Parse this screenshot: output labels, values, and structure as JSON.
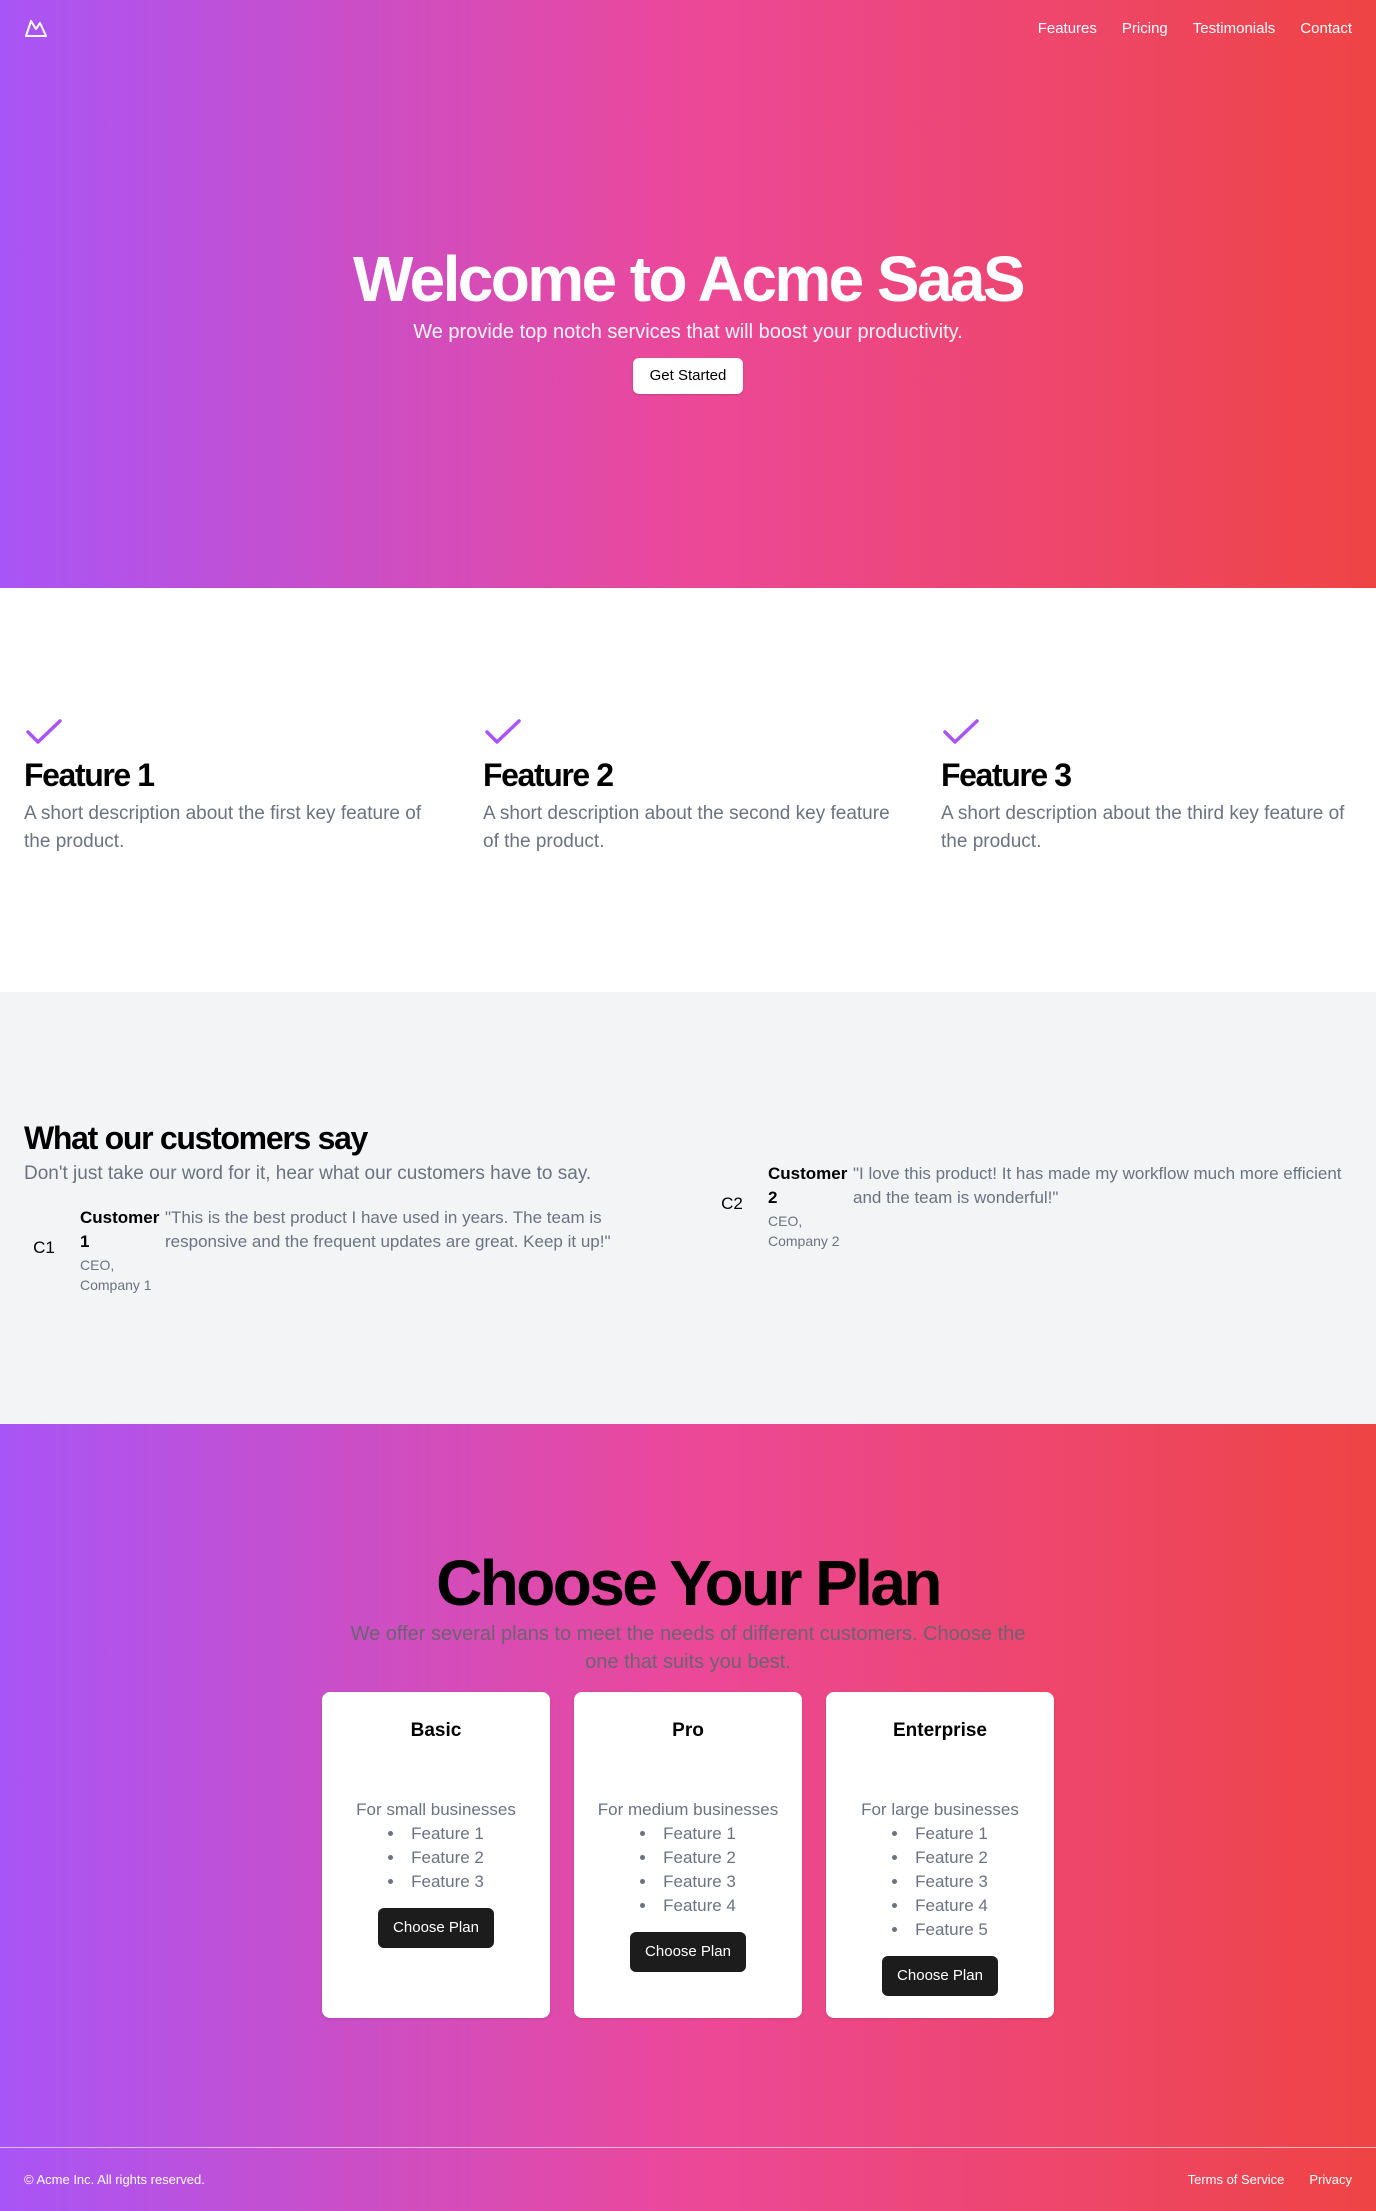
{
  "nav": {
    "logo_icon": "mountain-icon",
    "links": [
      "Features",
      "Pricing",
      "Testimonials",
      "Contact"
    ]
  },
  "hero": {
    "title": "Welcome to Acme SaaS",
    "subtitle": "We provide top notch services that will boost your productivity.",
    "cta": "Get Started"
  },
  "features": {
    "icon": "check-icon",
    "accent_color": "#a855f7",
    "items": [
      {
        "title": "Feature 1",
        "description": "A short description about the first key feature of the product."
      },
      {
        "title": "Feature 2",
        "description": "A short description about the second key feature of the product."
      },
      {
        "title": "Feature 3",
        "description": "A short description about the third key feature of the product."
      }
    ]
  },
  "testimonials": {
    "title": "What our customers say",
    "subtitle": "Don't just take our word for it, hear what our customers have to say.",
    "items": [
      {
        "initials": "C1",
        "name": "Customer 1",
        "role": "CEO, Company 1",
        "quote": "\"This is the best product I have used in years. The team is responsive and the frequent updates are great. Keep it up!\""
      },
      {
        "initials": "C2",
        "name": "Customer 2",
        "role": "CEO, Company 2",
        "quote": "\"I love this product! It has made my workflow much more efficient and the team is wonderful!\""
      }
    ]
  },
  "pricing": {
    "title": "Choose Your Plan",
    "subtitle": "We offer several plans to meet the needs of different customers. Choose the one that suits you best.",
    "plans": [
      {
        "name": "Basic",
        "description": "For small businesses",
        "features": [
          "Feature 1",
          "Feature 2",
          "Feature 3"
        ],
        "cta": "Choose Plan"
      },
      {
        "name": "Pro",
        "description": "For medium businesses",
        "features": [
          "Feature 1",
          "Feature 2",
          "Feature 3",
          "Feature 4"
        ],
        "cta": "Choose Plan"
      },
      {
        "name": "Enterprise",
        "description": "For large businesses",
        "features": [
          "Feature 1",
          "Feature 2",
          "Feature 3",
          "Feature 4",
          "Feature 5"
        ],
        "cta": "Choose Plan"
      }
    ]
  },
  "footer": {
    "copyright": "© Acme Inc. All rights reserved.",
    "links": [
      "Terms of Service",
      "Privacy"
    ]
  },
  "colors": {
    "gradient_start": "#a855f7",
    "gradient_mid": "#ec4899",
    "gradient_end": "#ef4444",
    "button_dark": "#1c1c1c",
    "muted_text": "#6b7280",
    "section_gray": "#f3f4f6"
  }
}
